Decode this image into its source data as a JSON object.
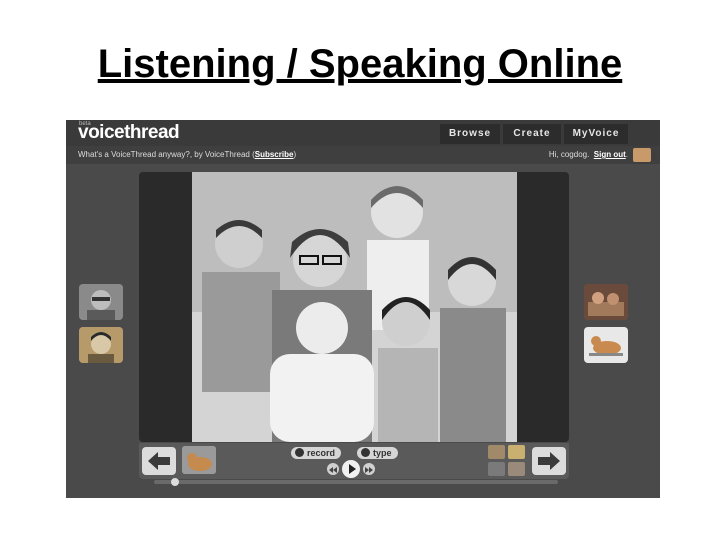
{
  "slide": {
    "title": "Listening / Speaking Online"
  },
  "app": {
    "beta_label": "beta",
    "logo": "voicethread",
    "nav": [
      "Browse",
      "Create",
      "MyVoice"
    ],
    "thread": {
      "title": "What's a VoiceThread anyway?",
      "by": ", by VoiceThread",
      "subscribe": "Subscribe"
    },
    "user": {
      "greeting": "Hi, cogdog.",
      "signout": "Sign out"
    }
  },
  "controls": {
    "record": "record",
    "type": "type"
  },
  "icons": {
    "prev": "left-arrow-icon",
    "next": "right-arrow-icon",
    "record": "microphone-icon",
    "type": "keyboard-icon",
    "play": "play-icon",
    "rewind": "rewind-icon",
    "forward": "fast-forward-icon"
  },
  "colors": {
    "chrome": "#4a4a4a",
    "topbar": "#3a3a3a",
    "button": "#dcdcdc"
  }
}
